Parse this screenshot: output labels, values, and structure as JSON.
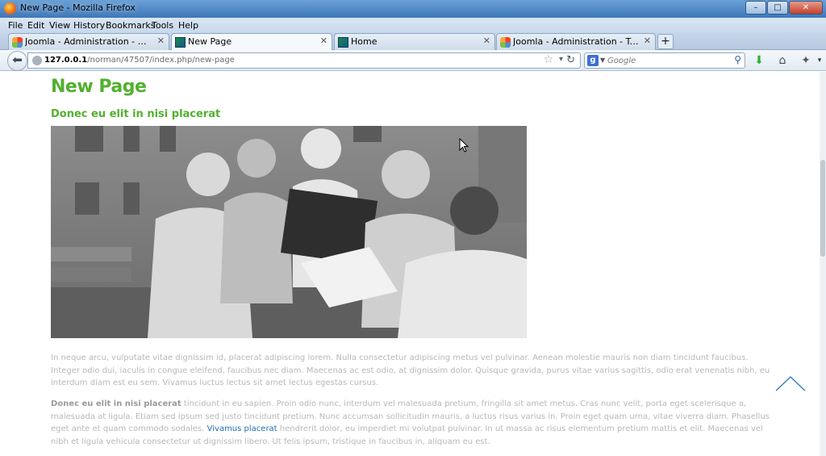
{
  "window": {
    "title": "New Page - Mozilla Firefox",
    "buttons": {
      "minimize": "–",
      "maximize": "□",
      "close": "✕"
    }
  },
  "menu": {
    "items": [
      "File",
      "Edit",
      "View",
      "History",
      "Bookmarks",
      "Tools",
      "Help"
    ]
  },
  "tabs": [
    {
      "label": "Joomla - Administration - Menu Man...",
      "favicon": "joomla-icon",
      "active": false
    },
    {
      "label": "New Page",
      "favicon": "site-icon",
      "active": true
    },
    {
      "label": "Home",
      "favicon": "site-icon",
      "active": false
    },
    {
      "label": "Joomla - Administration - Template ...",
      "favicon": "joomla-icon",
      "active": false
    }
  ],
  "newtab_label": "+",
  "navbar": {
    "url_host": "127.0.0.1",
    "url_path": "/norman/47507/index.php/new-page",
    "search_placeholder": "Google",
    "search_engine_letter": "g"
  },
  "page": {
    "title": "New Page",
    "article_title": "Donec eu elit in nisi placerat",
    "paragraph1": "In neque arcu, vulputate vitae dignissim id, placerat adipiscing lorem. Nulla consectetur adipiscing metus vel pulvinar. Aenean molestie mauris non diam tincidunt faucibus. Integer odio dui, iaculis in congue eleifend, faucibus nec diam. Maecenas ac est odio, at dignissim dolor. Quisque gravida, purus vitae varius sagittis, odio erat venenatis nibh, eu interdum diam est eu sem. Vivamus luctus lectus sit amet lectus egestas cursus.",
    "paragraph2_bold": "Donec eu elit in nisi placerat",
    "paragraph2_a": " tincidunt in eu sapien. Proin odio nunc, interdum vel malesuada pretium, fringilla sit amet metus. Cras nunc velit, porta eget scelerisque a, malesuada at ligula. Etiam sed ipsum sed justo tincidunt pretium. Nunc accumsan sollicitudin mauris, a luctus risus varius in. Proin eget quam urna, vitae viverra diam. Phasellus eget ante et quam commodo sodales. ",
    "paragraph2_link": "Vivamus placerat",
    "paragraph2_b": " hendrerit dolor, eu imperdiet mi volutpat pulvinar. In ut massa ac risus elementum pretium mattis et elit. Maecenas vel nibh et ligula vehicula consectetur ut dignissim libero. Ut felis ipsum, tristique in faucibus in, aliquam eu est."
  },
  "colors": {
    "accent_green": "#52b02f",
    "link_blue": "#1e6fb5",
    "body_text": "#b8b8b8"
  }
}
